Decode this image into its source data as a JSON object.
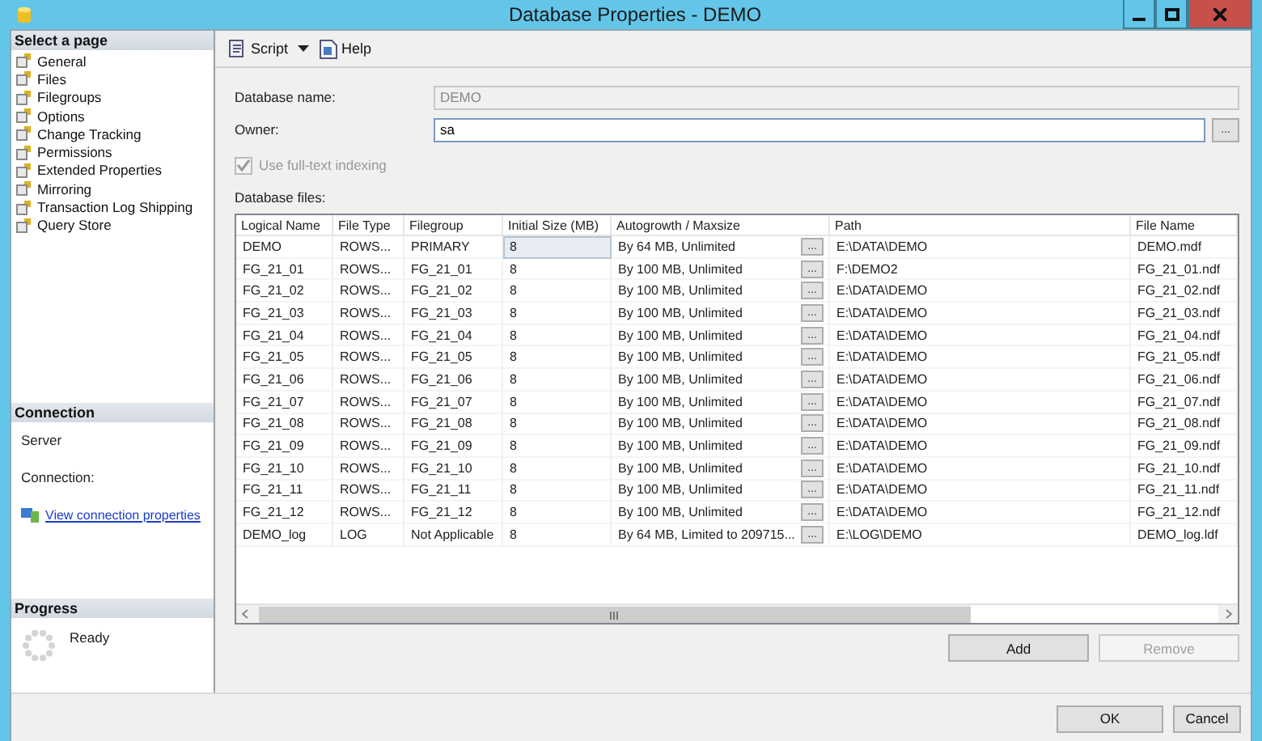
{
  "window": {
    "title": "Database Properties - DEMO"
  },
  "sidebar": {
    "header": "Select a page",
    "items": [
      {
        "label": "General"
      },
      {
        "label": "Files"
      },
      {
        "label": "Filegroups"
      },
      {
        "label": "Options"
      },
      {
        "label": "Change Tracking"
      },
      {
        "label": "Permissions"
      },
      {
        "label": "Extended Properties"
      },
      {
        "label": "Mirroring"
      },
      {
        "label": "Transaction Log Shipping"
      },
      {
        "label": "Query Store"
      }
    ]
  },
  "connection": {
    "header": "Connection",
    "server_label": "Server",
    "connection_label": "Connection:",
    "link": "View connection properties"
  },
  "progress": {
    "header": "Progress",
    "status": "Ready"
  },
  "toolbar": {
    "script": "Script",
    "help": "Help"
  },
  "form": {
    "database_name": {
      "label": "Database name:",
      "value": "DEMO",
      "disabled": true
    },
    "owner": {
      "label": "Owner:",
      "value": "sa",
      "browse": "..."
    },
    "fulltext": {
      "label": "Use full-text indexing",
      "checked": true,
      "disabled": true
    },
    "files_label": "Database files:"
  },
  "table": {
    "columns": [
      "Logical Name",
      "File Type",
      "Filegroup",
      "Initial Size (MB)",
      "Autogrowth / Maxsize",
      "Path",
      "File Name"
    ],
    "rows": [
      {
        "name": "DEMO",
        "type": "ROWS...",
        "filegroup": "PRIMARY",
        "size": "8",
        "growth": "By 64 MB, Unlimited",
        "browse": "...",
        "path": "E:\\DATA\\DEMO",
        "file": "DEMO.mdf",
        "selected": true
      },
      {
        "name": "FG_21_01",
        "type": "ROWS...",
        "filegroup": "FG_21_01",
        "size": "8",
        "growth": "By 100 MB, Unlimited",
        "browse": "...",
        "path": "F:\\DEMO2",
        "file": "FG_21_01.ndf",
        "selected": false
      },
      {
        "name": "FG_21_02",
        "type": "ROWS...",
        "filegroup": "FG_21_02",
        "size": "8",
        "growth": "By 100 MB, Unlimited",
        "browse": "...",
        "path": "E:\\DATA\\DEMO",
        "file": "FG_21_02.ndf",
        "selected": false
      },
      {
        "name": "FG_21_03",
        "type": "ROWS...",
        "filegroup": "FG_21_03",
        "size": "8",
        "growth": "By 100 MB, Unlimited",
        "browse": "...",
        "path": "E:\\DATA\\DEMO",
        "file": "FG_21_03.ndf",
        "selected": false
      },
      {
        "name": "FG_21_04",
        "type": "ROWS...",
        "filegroup": "FG_21_04",
        "size": "8",
        "growth": "By 100 MB, Unlimited",
        "browse": "...",
        "path": "E:\\DATA\\DEMO",
        "file": "FG_21_04.ndf",
        "selected": false
      },
      {
        "name": "FG_21_05",
        "type": "ROWS...",
        "filegroup": "FG_21_05",
        "size": "8",
        "growth": "By 100 MB, Unlimited",
        "browse": "...",
        "path": "E:\\DATA\\DEMO",
        "file": "FG_21_05.ndf",
        "selected": false
      },
      {
        "name": "FG_21_06",
        "type": "ROWS...",
        "filegroup": "FG_21_06",
        "size": "8",
        "growth": "By 100 MB, Unlimited",
        "browse": "...",
        "path": "E:\\DATA\\DEMO",
        "file": "FG_21_06.ndf",
        "selected": false
      },
      {
        "name": "FG_21_07",
        "type": "ROWS...",
        "filegroup": "FG_21_07",
        "size": "8",
        "growth": "By 100 MB, Unlimited",
        "browse": "...",
        "path": "E:\\DATA\\DEMO",
        "file": "FG_21_07.ndf",
        "selected": false
      },
      {
        "name": "FG_21_08",
        "type": "ROWS...",
        "filegroup": "FG_21_08",
        "size": "8",
        "growth": "By 100 MB, Unlimited",
        "browse": "...",
        "path": "E:\\DATA\\DEMO",
        "file": "FG_21_08.ndf",
        "selected": false
      },
      {
        "name": "FG_21_09",
        "type": "ROWS...",
        "filegroup": "FG_21_09",
        "size": "8",
        "growth": "By 100 MB, Unlimited",
        "browse": "...",
        "path": "E:\\DATA\\DEMO",
        "file": "FG_21_09.ndf",
        "selected": false
      },
      {
        "name": "FG_21_10",
        "type": "ROWS...",
        "filegroup": "FG_21_10",
        "size": "8",
        "growth": "By 100 MB, Unlimited",
        "browse": "...",
        "path": "E:\\DATA\\DEMO",
        "file": "FG_21_10.ndf",
        "selected": false
      },
      {
        "name": "FG_21_11",
        "type": "ROWS...",
        "filegroup": "FG_21_11",
        "size": "8",
        "growth": "By 100 MB, Unlimited",
        "browse": "...",
        "path": "E:\\DATA\\DEMO",
        "file": "FG_21_11.ndf",
        "selected": false
      },
      {
        "name": "FG_21_12",
        "type": "ROWS...",
        "filegroup": "FG_21_12",
        "size": "8",
        "growth": "By 100 MB, Unlimited",
        "browse": "...",
        "path": "E:\\DATA\\DEMO",
        "file": "FG_21_12.ndf",
        "selected": false
      },
      {
        "name": "DEMO_log",
        "type": "LOG",
        "filegroup": "Not Applicable",
        "size": "8",
        "growth": "By 64 MB, Limited to 209715...",
        "browse": "...",
        "path": "E:\\LOG\\DEMO",
        "file": "DEMO_log.ldf",
        "selected": false
      }
    ]
  },
  "table_buttons": [
    {
      "label": "Add",
      "disabled": false
    },
    {
      "label": "Remove",
      "disabled": true
    }
  ],
  "dialog_buttons": [
    "OK",
    "Cancel"
  ]
}
